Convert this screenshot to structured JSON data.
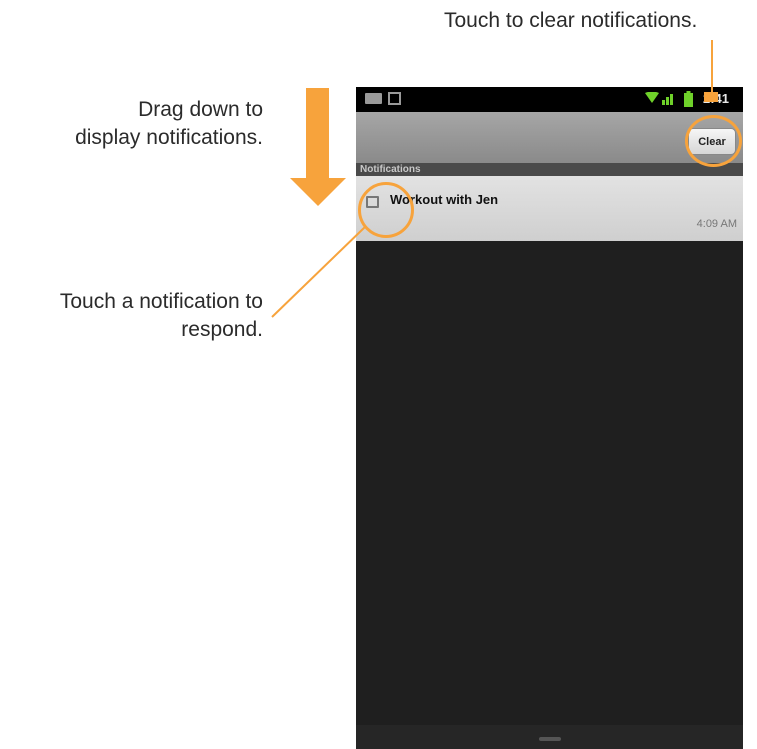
{
  "callouts": {
    "clear": "Touch to clear notifications.",
    "drag_line1": "Drag down to",
    "drag_line2": "display notifications.",
    "touch_line1": "Touch a notification to",
    "touch_line2": "respond."
  },
  "status_bar": {
    "time": "2:41",
    "icons": [
      "mail-icon",
      "calendar-icon",
      "wifi-icon",
      "signal-icon",
      "battery-icon"
    ]
  },
  "toolbar": {
    "clear_label": "Clear"
  },
  "notifications": {
    "header": "Notifications",
    "items": [
      {
        "title": "Workout with Jen",
        "time": "4:09 AM",
        "icon": "calendar-icon"
      }
    ]
  },
  "colors": {
    "accent": "#f7a33c",
    "status_bar": "#000000",
    "toolbar": "#9a9a9a",
    "list_bg": "#1f1f1f"
  }
}
